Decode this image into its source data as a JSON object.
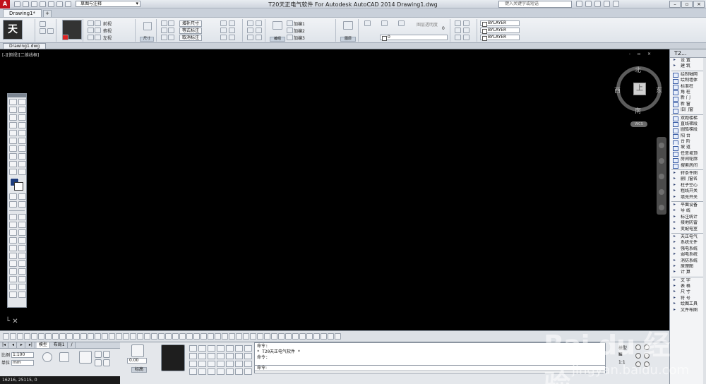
{
  "window": {
    "title": "T20天正电气软件 For Autodesk AutoCAD 2014    Drawing1.dwg",
    "workspace": "草图与注释",
    "search_placeholder": "键入关键字或短语",
    "logo": "A"
  },
  "tabs": {
    "doc_tab": "Drawing1*",
    "file_tab": "Drawing1.dwg"
  },
  "ribbon": {
    "views": [
      "前视",
      "俯视",
      "左视"
    ],
    "size_button": "尺寸",
    "dim_buttons": [
      "增补尺寸",
      "等式标注",
      "取消标注"
    ],
    "group_button": "编组",
    "groups": [
      "加编1",
      "加编2",
      "加编3"
    ],
    "layer_label": "图层",
    "layer_value": "0",
    "transparency_label": "图层透明度",
    "transparency_value": "0",
    "bylayer": [
      "BYLAYER",
      "BYLAYER",
      "BYLAYER"
    ]
  },
  "viewport": {
    "label": "[-][俯视][二维线框]",
    "close": "- ▫ ×"
  },
  "viewcube": {
    "top": "上",
    "north": "北",
    "south": "南",
    "east": "东",
    "west": "西",
    "wcs": "WCS"
  },
  "right_panel": {
    "title": "T2...",
    "sections": [
      [
        "设  置",
        "建  筑"
      ],
      [
        "绘制轴网",
        "绘制墙体",
        "标准柱",
        "角  柱",
        "新  门",
        "新  窗",
        "旧门窗"
      ],
      [
        "双跑楼梯",
        "直线梯段",
        "圆弧梯段",
        "阳  台",
        "台  阶",
        "坡  道",
        "任意坡顶",
        "房间轮廓",
        "搜索房间"
      ],
      [
        "转条件图",
        "删门窗名",
        "柱子空心",
        "粗线开关",
        "填充开关"
      ],
      [
        "平面设备",
        "导  线",
        "标注统计",
        "接地防雷",
        "变配电室"
      ],
      [
        "天正电气",
        "系统元件",
        "强电系统",
        "弱电系统",
        "消防系统",
        "原理图",
        "计  算"
      ],
      [
        "文  字",
        "表  格",
        "尺  寸",
        "符  号",
        "绘图工具",
        "文件布图"
      ]
    ]
  },
  "status": {
    "layout_tabs": [
      "模型",
      "布局1",
      "/"
    ],
    "scale_label": "比例",
    "scale_value": "1:100",
    "unit_label": "单位",
    "unit_value": "mm",
    "coords": "16216, 25115, 0",
    "style_value": "0.00",
    "style_label": "标高"
  },
  "command": {
    "lines": [
      "命令:",
      "* T20天正电气软件 *",
      "命令:",
      "命令:"
    ],
    "input_prompt": "命令:"
  },
  "tray": {
    "labels": [
      "模型",
      "▦",
      "1:1"
    ]
  },
  "watermark": {
    "brand": "Bai du 经验",
    "url": "jingyan.baidu.com"
  }
}
